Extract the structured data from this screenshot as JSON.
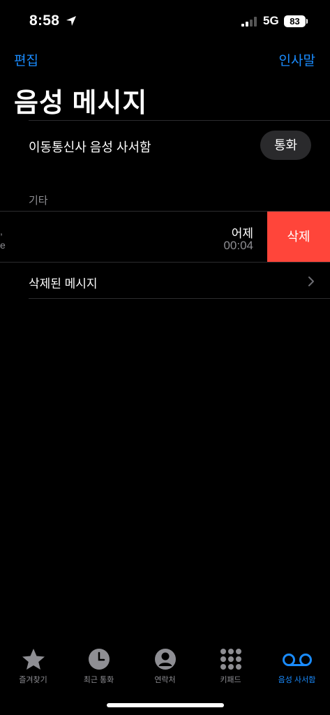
{
  "status": {
    "time": "8:58",
    "network": "5G",
    "battery": "83"
  },
  "nav": {
    "edit": "편집",
    "greeting": "인사말"
  },
  "page_title": "음성 메시지",
  "carrier": {
    "label": "이동통신사 음성 사서함",
    "call_button": "통화"
  },
  "section_other": "기타",
  "voicemail_row": {
    "left_fragment_1": ",",
    "left_fragment_2": "e",
    "date": "어제",
    "duration": "00:04",
    "delete_label": "삭제"
  },
  "deleted_messages": "삭제된 메시지",
  "colors": {
    "accent": "#1a8cff",
    "delete": "#ff453a",
    "background": "#000000"
  },
  "tabs": [
    {
      "label": "즐겨찾기",
      "icon": "star-icon",
      "active": false
    },
    {
      "label": "최근 통화",
      "icon": "clock-icon",
      "active": false
    },
    {
      "label": "연락처",
      "icon": "person-icon",
      "active": false
    },
    {
      "label": "키패드",
      "icon": "keypad-icon",
      "active": false
    },
    {
      "label": "음성 사서함",
      "icon": "voicemail-icon",
      "active": true
    }
  ]
}
